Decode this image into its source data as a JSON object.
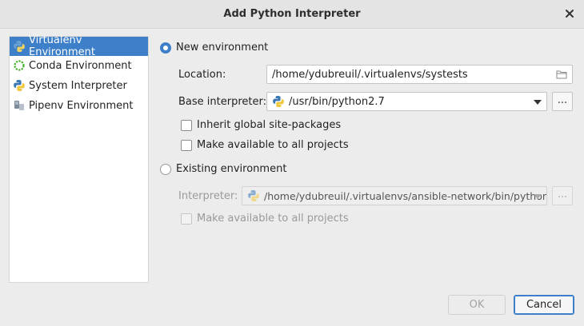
{
  "window": {
    "title": "Add Python Interpreter",
    "close_icon": "close-icon"
  },
  "sidebar": {
    "items": [
      {
        "label": "Virtualenv Environment",
        "icon": "python-virtualenv-icon",
        "selected": true
      },
      {
        "label": "Conda Environment",
        "icon": "conda-icon",
        "selected": false
      },
      {
        "label": "System Interpreter",
        "icon": "python-icon",
        "selected": false
      },
      {
        "label": "Pipenv Environment",
        "icon": "pipenv-icon",
        "selected": false
      }
    ]
  },
  "new_env": {
    "radio_label": "New environment",
    "selected": true,
    "location_label": "Location:",
    "location_value": "/home/ydubreuil/.virtualenvs/systests",
    "base_interpreter_label": "Base interpreter:",
    "base_interpreter_value": "/usr/bin/python2.7",
    "browse_label": "...",
    "inherit_label": "Inherit global site-packages",
    "inherit_checked": false,
    "make_available_label": "Make available to all projects",
    "make_available_checked": false
  },
  "existing_env": {
    "radio_label": "Existing environment",
    "selected": false,
    "interpreter_label": "Interpreter:",
    "interpreter_value": "/home/ydubreuil/.virtualenvs/ansible-network/bin/python",
    "browse_label": "...",
    "make_available_label": "Make available to all projects",
    "make_available_checked": false
  },
  "footer": {
    "ok_label": "OK",
    "cancel_label": "Cancel"
  },
  "colors": {
    "accent": "#3d7fc8",
    "background": "#ececec"
  }
}
